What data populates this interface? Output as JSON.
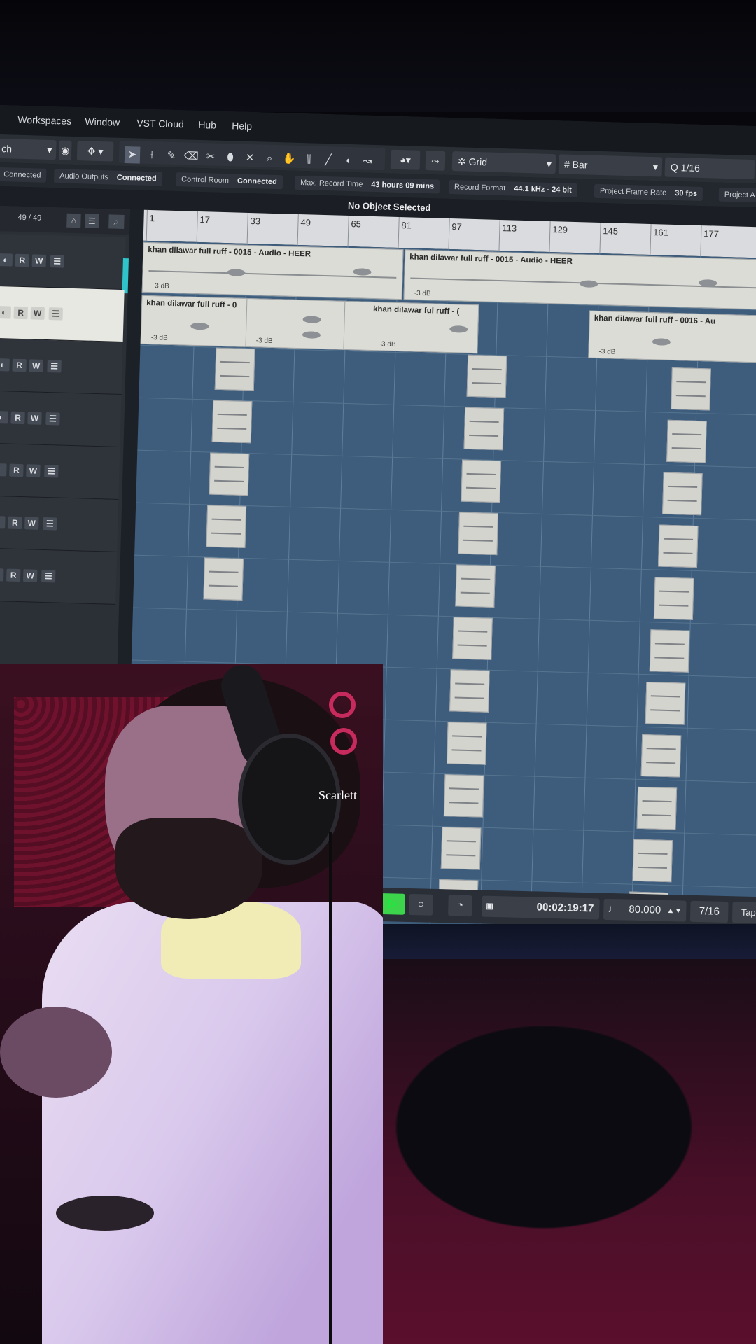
{
  "menu": {
    "partial_left": "",
    "items": [
      "Workspaces",
      "Window",
      "VST Cloud",
      "Hub",
      "Help"
    ]
  },
  "toolbar": {
    "preset_partial": "ch",
    "snap_type": "Grid",
    "grid_type": "Bar",
    "quantize": "1/16"
  },
  "status": {
    "items": [
      {
        "label": "Connected",
        "value": ""
      },
      {
        "label": "Audio Outputs",
        "value": "Connected"
      },
      {
        "label": "Control Room",
        "value": "Connected"
      },
      {
        "label": "Max. Record Time",
        "value": "43 hours 09 mins"
      },
      {
        "label": "Record Format",
        "value": "44.1 kHz - 24 bit"
      },
      {
        "label": "Project Frame Rate",
        "value": "30 fps"
      },
      {
        "label": "Project A",
        "value": ""
      }
    ]
  },
  "info_line": "No Object Selected",
  "track_panel": {
    "count": "49 / 49",
    "button_labels": [
      "R",
      "W"
    ]
  },
  "ruler": {
    "start_marker": "1",
    "bars": [
      "17",
      "33",
      "49",
      "65",
      "81",
      "97",
      "113",
      "129",
      "145",
      "161",
      "177"
    ]
  },
  "clips": {
    "c1": {
      "name": "khan dilawar full ruff - 0015 - Audio - HEER",
      "gain": "-3 dB"
    },
    "c2": {
      "name": "khan dilawar full ruff - 0015 - Audio - HEER",
      "gain": "-3 dB"
    },
    "c3": {
      "name": "khan dilawar full ruff - 0",
      "gain": "-3 dB"
    },
    "c4": {
      "name": "",
      "gain": "-3 dB"
    },
    "c5": {
      "name": "khan dilawar ful ruff - (",
      "gain": "-3 dB"
    },
    "c6": {
      "name": "khan dilawar full ruff - 0016 - Au",
      "gain": "-3 dB"
    }
  },
  "transport": {
    "time": "00:02:19:17",
    "tempo": "80.000",
    "signature": "7/16",
    "tap_label": "Tap"
  },
  "camera": {
    "headphone_brand": "Scarlett"
  }
}
